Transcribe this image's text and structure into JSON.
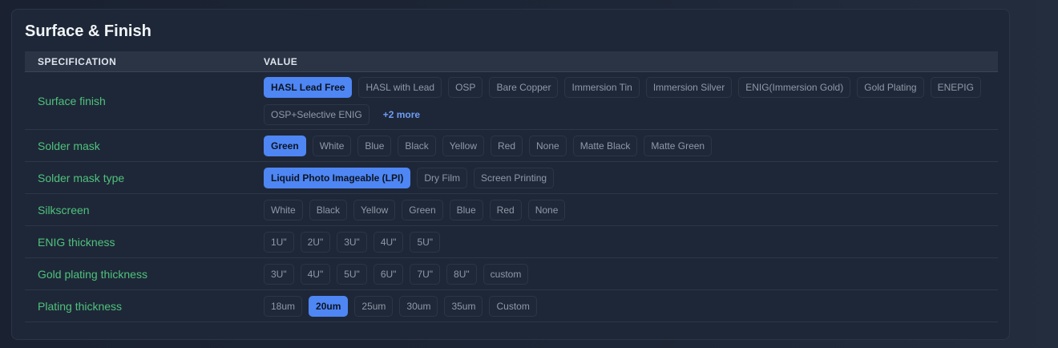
{
  "title": "Surface & Finish",
  "headers": {
    "spec": "SPECIFICATION",
    "value": "VALUE"
  },
  "rows": [
    {
      "label": "Surface finish",
      "options": [
        "HASL Lead Free",
        "HASL with Lead",
        "OSP",
        "Bare Copper",
        "Immersion Tin",
        "Immersion Silver",
        "ENIG(Immersion Gold)",
        "Gold Plating",
        "ENEPIG",
        "OSP+Selective ENIG"
      ],
      "selected": "HASL Lead Free",
      "more": "+2 more"
    },
    {
      "label": "Solder mask",
      "options": [
        "Green",
        "White",
        "Blue",
        "Black",
        "Yellow",
        "Red",
        "None",
        "Matte Black",
        "Matte Green"
      ],
      "selected": "Green"
    },
    {
      "label": "Solder mask type",
      "options": [
        "Liquid Photo Imageable (LPI)",
        "Dry Film",
        "Screen Printing"
      ],
      "selected": "Liquid Photo Imageable (LPI)"
    },
    {
      "label": "Silkscreen",
      "options": [
        "White",
        "Black",
        "Yellow",
        "Green",
        "Blue",
        "Red",
        "None"
      ],
      "selected": ""
    },
    {
      "label": "ENIG thickness",
      "options": [
        "1U\"",
        "2U\"",
        "3U\"",
        "4U\"",
        "5U\""
      ],
      "selected": ""
    },
    {
      "label": "Gold plating thickness",
      "options": [
        "3U\"",
        "4U\"",
        "5U\"",
        "6U\"",
        "7U\"",
        "8U\"",
        "custom"
      ],
      "selected": ""
    },
    {
      "label": "Plating thickness",
      "options": [
        "18um",
        "20um",
        "25um",
        "30um",
        "35um",
        "Custom"
      ],
      "selected": "20um"
    }
  ],
  "colors": {
    "accent": "#4e86f4",
    "label": "#4fc27d",
    "background": "#1e2737"
  }
}
